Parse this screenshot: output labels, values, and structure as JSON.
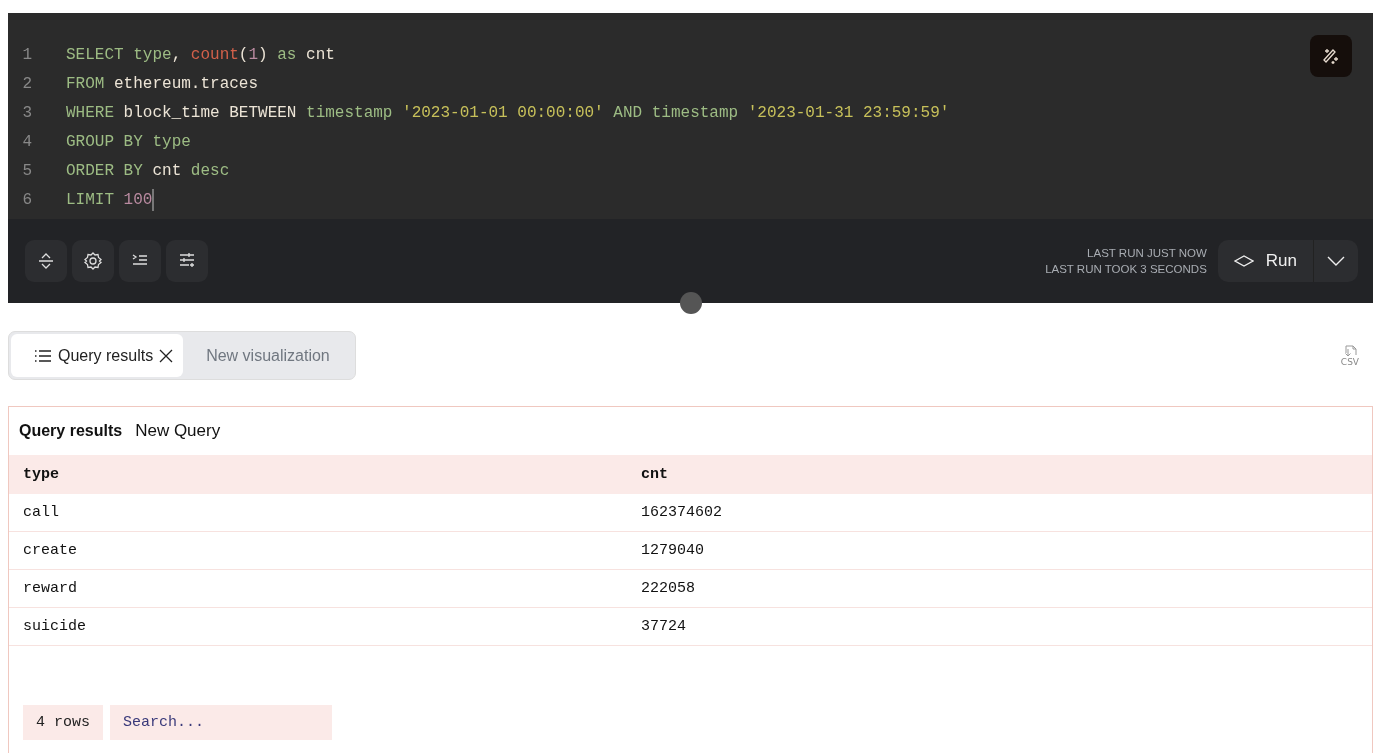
{
  "editor": {
    "lines": [
      {
        "number": "1",
        "has_cursor": false,
        "tokens": [
          {
            "text": "SELECT ",
            "kind": "keyword"
          },
          {
            "text": "type",
            "kind": "keyword"
          },
          {
            "text": ", ",
            "kind": "plain"
          },
          {
            "text": "count",
            "kind": "function"
          },
          {
            "text": "(",
            "kind": "plain"
          },
          {
            "text": "1",
            "kind": "number"
          },
          {
            "text": ") ",
            "kind": "plain"
          },
          {
            "text": "as ",
            "kind": "keyword"
          },
          {
            "text": "cnt",
            "kind": "plain"
          }
        ]
      },
      {
        "number": "2",
        "has_cursor": false,
        "tokens": [
          {
            "text": "FROM ",
            "kind": "keyword"
          },
          {
            "text": "ethereum.traces",
            "kind": "plain"
          }
        ]
      },
      {
        "number": "3",
        "has_cursor": false,
        "tokens": [
          {
            "text": "WHERE ",
            "kind": "keyword"
          },
          {
            "text": "block_time BETWEEN ",
            "kind": "plain"
          },
          {
            "text": "timestamp ",
            "kind": "keyword"
          },
          {
            "text": "'2023-01-01 00:00:00'",
            "kind": "string"
          },
          {
            "text": " AND ",
            "kind": "keyword"
          },
          {
            "text": "timestamp ",
            "kind": "keyword"
          },
          {
            "text": "'2023-01-31 23:59:59'",
            "kind": "string"
          }
        ]
      },
      {
        "number": "4",
        "has_cursor": false,
        "tokens": [
          {
            "text": "GROUP BY ",
            "kind": "keyword"
          },
          {
            "text": "type",
            "kind": "keyword"
          }
        ]
      },
      {
        "number": "5",
        "has_cursor": false,
        "tokens": [
          {
            "text": "ORDER BY ",
            "kind": "keyword"
          },
          {
            "text": "cnt ",
            "kind": "plain"
          },
          {
            "text": "desc",
            "kind": "keyword"
          }
        ]
      },
      {
        "number": "6",
        "has_cursor": true,
        "tokens": [
          {
            "text": "LIMIT ",
            "kind": "keyword"
          },
          {
            "text": "100",
            "kind": "number"
          }
        ]
      }
    ],
    "last_run": [
      "LAST RUN JUST NOW",
      "LAST RUN TOOK 3 SECONDS"
    ],
    "run_button": "Run"
  },
  "csv_button": "CSV",
  "tabs": [
    {
      "label": "Query results",
      "selected": true,
      "closable": true
    },
    {
      "label": "New visualization",
      "selected": false,
      "closable": false
    }
  ],
  "results": {
    "title": "Query results",
    "subtitle": "New Query",
    "columns": [
      "type",
      "cnt"
    ],
    "rows": [
      [
        "call",
        "162374602"
      ],
      [
        "create",
        "1279040"
      ],
      [
        "reward",
        "222058"
      ],
      [
        "suicide",
        "37724"
      ]
    ],
    "row_count": "4 rows",
    "search": {
      "placeholder": "Search..."
    }
  }
}
